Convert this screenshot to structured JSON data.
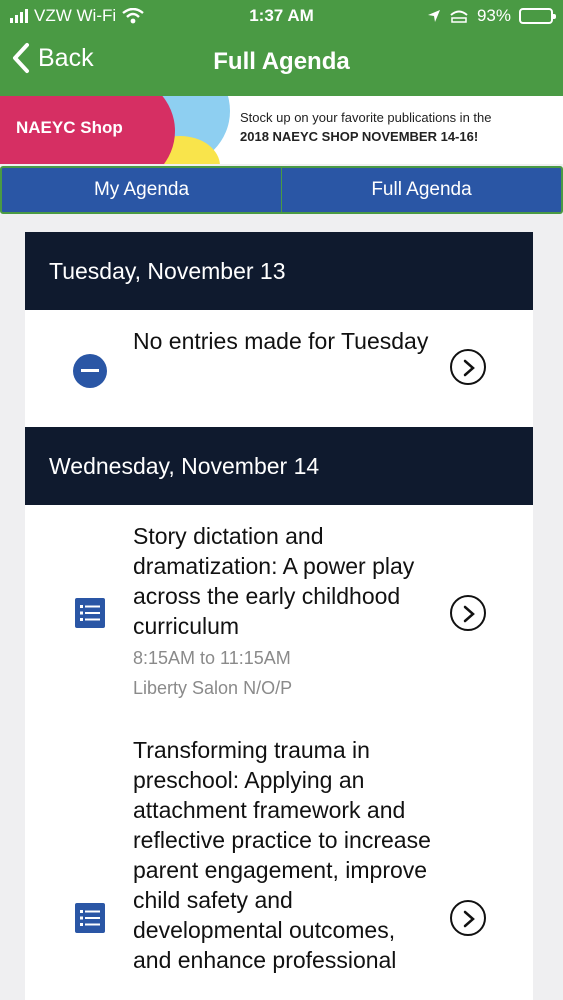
{
  "status": {
    "carrier": "VZW Wi-Fi",
    "time": "1:37 AM",
    "battery": "93%",
    "battery_level": 0.93
  },
  "nav": {
    "back_label": "Back",
    "title": "Full Agenda"
  },
  "banner": {
    "shop_label": "NAEYC Shop",
    "promo_line1": "Stock up on your favorite publications in the",
    "promo_line2": "2018 NAEYC SHOP NOVEMBER 14-16!"
  },
  "tabs": [
    {
      "label": "My Agenda"
    },
    {
      "label": "Full Agenda"
    }
  ],
  "days": [
    {
      "header": "Tuesday, November 13",
      "entries": [
        {
          "title": "No entries made for Tuesday"
        }
      ]
    },
    {
      "header": "Wednesday, November 14",
      "entries": [
        {
          "title": "Story dictation and dramatization: A power play across the early childhood curriculum",
          "time": "8:15AM to 11:15AM",
          "location": "Liberty Salon N/O/P"
        },
        {
          "title": "Transforming trauma in preschool: Applying an attachment framework and reflective practice to increase parent engagement, improve child safety and developmental outcomes, and enhance professional"
        }
      ]
    }
  ],
  "colors": {
    "nav_green": "#4a9a44",
    "accent_blue": "#2a56a5",
    "header_navy": "#0f1a2e",
    "shop_pink": "#d62f63"
  }
}
